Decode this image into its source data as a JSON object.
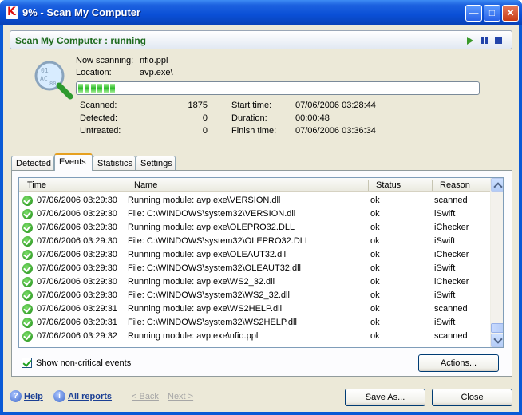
{
  "window": {
    "title": "9% - Scan My Computer",
    "icon": "kaspersky-k-icon"
  },
  "status": {
    "title": "Scan My Computer : running"
  },
  "scan": {
    "now_scanning_label": "Now scanning:",
    "now_scanning_value": "nfio.ppl",
    "location_label": "Location:",
    "location_value": "avp.exe\\",
    "progress_percent": 9,
    "scanned_label": "Scanned:",
    "scanned_value": "1875",
    "detected_label": "Detected:",
    "detected_value": "0",
    "untreated_label": "Untreated:",
    "untreated_value": "0",
    "start_label": "Start time:",
    "start_value": "07/06/2006 03:28:44",
    "duration_label": "Duration:",
    "duration_value": "00:00:48",
    "finish_label": "Finish time:",
    "finish_value": "07/06/2006 03:36:34"
  },
  "tabs": [
    {
      "label": "Detected"
    },
    {
      "label": "Events"
    },
    {
      "label": "Statistics"
    },
    {
      "label": "Settings"
    }
  ],
  "table": {
    "columns": [
      "Time",
      "Name",
      "Status",
      "Reason"
    ],
    "rows": [
      [
        "07/06/2006 03:29:30",
        "Running module: avp.exe\\VERSION.dll",
        "ok",
        "scanned"
      ],
      [
        "07/06/2006 03:29:30",
        "File: C:\\WINDOWS\\system32\\VERSION.dll",
        "ok",
        "iSwift"
      ],
      [
        "07/06/2006 03:29:30",
        "Running module: avp.exe\\OLEPRO32.DLL",
        "ok",
        "iChecker"
      ],
      [
        "07/06/2006 03:29:30",
        "File: C:\\WINDOWS\\system32\\OLEPRO32.DLL",
        "ok",
        "iSwift"
      ],
      [
        "07/06/2006 03:29:30",
        "Running module: avp.exe\\OLEAUT32.dll",
        "ok",
        "iChecker"
      ],
      [
        "07/06/2006 03:29:30",
        "File: C:\\WINDOWS\\system32\\OLEAUT32.dll",
        "ok",
        "iSwift"
      ],
      [
        "07/06/2006 03:29:30",
        "Running module: avp.exe\\WS2_32.dll",
        "ok",
        "iChecker"
      ],
      [
        "07/06/2006 03:29:30",
        "File: C:\\WINDOWS\\system32\\WS2_32.dll",
        "ok",
        "iSwift"
      ],
      [
        "07/06/2006 03:29:31",
        "Running module: avp.exe\\WS2HELP.dll",
        "ok",
        "scanned"
      ],
      [
        "07/06/2006 03:29:31",
        "File: C:\\WINDOWS\\system32\\WS2HELP.dll",
        "ok",
        "iSwift"
      ],
      [
        "07/06/2006 03:29:32",
        "Running module: avp.exe\\nfio.ppl",
        "ok",
        "scanned"
      ]
    ]
  },
  "show_noncritical_label": "Show non-critical events",
  "buttons": {
    "actions": "Actions...",
    "save_as": "Save As...",
    "close": "Close"
  },
  "footer": {
    "help": "Help",
    "all_reports": "All reports",
    "back": "< Back",
    "next": "Next >"
  },
  "colors": {
    "ok_green": "#2fbb2a",
    "status_title": "#1e6a1e",
    "link": "#1b3f94"
  }
}
